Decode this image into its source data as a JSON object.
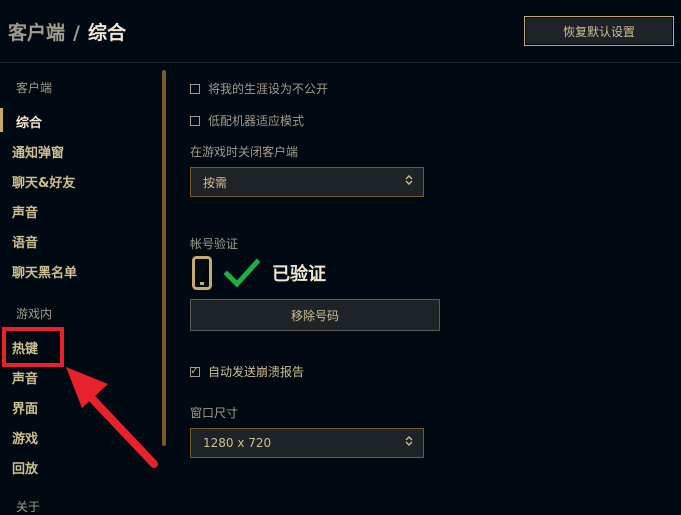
{
  "header": {
    "breadcrumb_parent": "客户端",
    "breadcrumb_separator": "/",
    "breadcrumb_current": "综合",
    "restore_defaults": "恢复默认设置"
  },
  "sidebar": {
    "group_client": "客户端",
    "client_items": [
      "综合",
      "通知弹窗",
      "聊天&好友",
      "声音",
      "语音",
      "聊天黑名单"
    ],
    "group_ingame": "游戏内",
    "ingame_items": [
      "热键",
      "声音",
      "界面",
      "游戏",
      "回放"
    ],
    "group_about": "关于",
    "active_item": "综合"
  },
  "settings": {
    "private_career": {
      "label": "将我的生涯设为不公开",
      "checked": false
    },
    "low_spec": {
      "label": "低配机器适应模式",
      "checked": false
    },
    "close_client_label": "在游戏时关闭客户端",
    "close_client_value": "按需",
    "account_verify_label": "帐号验证",
    "verified_text": "已验证",
    "remove_number": "移除号码",
    "auto_crash_report": {
      "label": "自动发送崩溃报告",
      "checked": true
    },
    "window_size_label": "窗口尺寸",
    "window_size_value": "1280 x 720"
  },
  "annotation": {
    "color": "#e8222b",
    "highlighted_item": "热键"
  },
  "colors": {
    "background": "#010a13",
    "gold": "#c8aa6e",
    "text": "#f0e6d2",
    "muted": "#a09b8c",
    "check_green": "#1fae44"
  }
}
